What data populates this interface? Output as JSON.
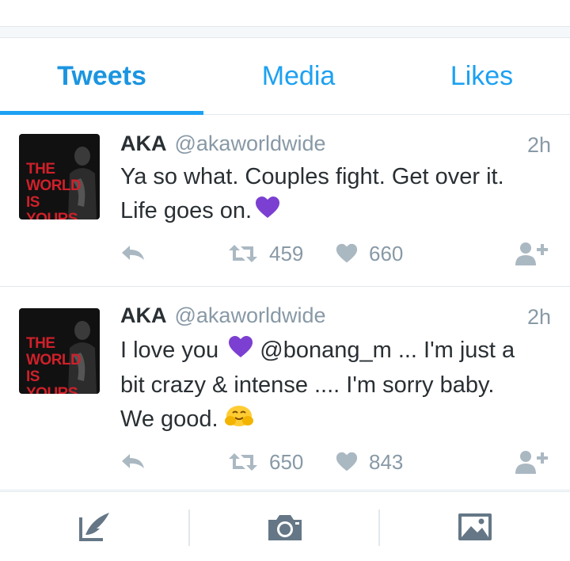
{
  "tabs": [
    {
      "label": "Tweets",
      "active": true
    },
    {
      "label": "Media",
      "active": false
    },
    {
      "label": "Likes",
      "active": false
    }
  ],
  "avatar_text": "THE WORLD IS YOURS",
  "tweets": [
    {
      "name": "AKA",
      "handle": "@akaworldwide",
      "time": "2h",
      "lines": [
        "Ya so what. Couples fight. Get over it.",
        "Life goes on."
      ],
      "retweets": "459",
      "likes": "660"
    },
    {
      "name": "AKA",
      "handle": "@akaworldwide",
      "time": "2h",
      "line1a": "I love you",
      "line1b": "@bonang_m ... I'm just a",
      "line2": "bit crazy & intense .... I'm sorry baby.",
      "line3": "We good.",
      "retweets": "650",
      "likes": "843"
    }
  ],
  "icons": {
    "reply": "reply-icon",
    "retweet": "retweet-icon",
    "like": "heart-icon",
    "follow": "follow-icon",
    "compose": "compose-tweet-icon",
    "camera": "camera-icon",
    "gallery": "gallery-icon"
  },
  "colors": {
    "accent": "#1da1f2",
    "muted": "#aab8c2",
    "purple_heart": "#7b3fd1"
  }
}
